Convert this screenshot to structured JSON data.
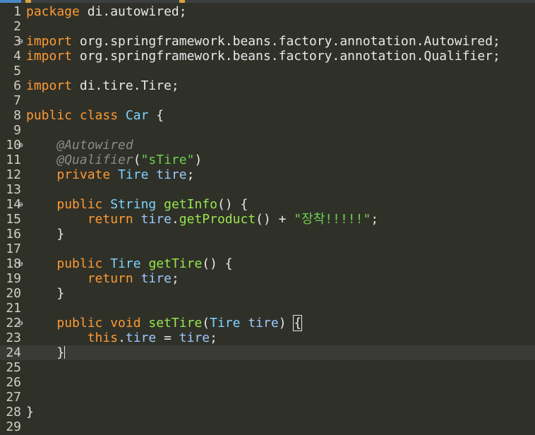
{
  "editor": {
    "language": "java",
    "current_line": 24,
    "lines": [
      {
        "n": "1",
        "fold": "",
        "tokens": [
          {
            "t": "kw",
            "v": "package"
          },
          {
            "t": "plain",
            "v": " di.autowired;"
          }
        ]
      },
      {
        "n": "2",
        "fold": "",
        "tokens": []
      },
      {
        "n": "3",
        "fold": "⊖",
        "tokens": [
          {
            "t": "kw",
            "v": "import"
          },
          {
            "t": "plain",
            "v": " org.springframework.beans.factory.annotation.Autowired;"
          }
        ]
      },
      {
        "n": "4",
        "fold": "",
        "tokens": [
          {
            "t": "kw",
            "v": "import"
          },
          {
            "t": "plain",
            "v": " org.springframework.beans.factory.annotation.Qualifier;"
          }
        ]
      },
      {
        "n": "5",
        "fold": "",
        "tokens": []
      },
      {
        "n": "6",
        "fold": "",
        "tokens": [
          {
            "t": "kw",
            "v": "import"
          },
          {
            "t": "plain",
            "v": " di.tire.Tire;"
          }
        ]
      },
      {
        "n": "7",
        "fold": "",
        "tokens": []
      },
      {
        "n": "8",
        "fold": "",
        "tokens": [
          {
            "t": "kw",
            "v": "public class"
          },
          {
            "t": "plain",
            "v": " "
          },
          {
            "t": "type",
            "v": "Car"
          },
          {
            "t": "plain",
            "v": " {"
          }
        ]
      },
      {
        "n": "9",
        "fold": "",
        "tokens": []
      },
      {
        "n": "10",
        "fold": "⊖",
        "tokens": [
          {
            "t": "plain",
            "v": "    "
          },
          {
            "t": "ann",
            "v": "@Autowired"
          }
        ]
      },
      {
        "n": "11",
        "fold": "",
        "tokens": [
          {
            "t": "plain",
            "v": "    "
          },
          {
            "t": "ann",
            "v": "@Qualifier"
          },
          {
            "t": "plain",
            "v": "("
          },
          {
            "t": "str",
            "v": "\"sTire\""
          },
          {
            "t": "plain",
            "v": ")"
          }
        ]
      },
      {
        "n": "12",
        "fold": "",
        "tokens": [
          {
            "t": "plain",
            "v": "    "
          },
          {
            "t": "kw",
            "v": "private"
          },
          {
            "t": "plain",
            "v": " "
          },
          {
            "t": "type",
            "v": "Tire"
          },
          {
            "t": "plain",
            "v": " "
          },
          {
            "t": "fld",
            "v": "tire"
          },
          {
            "t": "plain",
            "v": ";"
          }
        ]
      },
      {
        "n": "13",
        "fold": "",
        "tokens": []
      },
      {
        "n": "14",
        "fold": "⊖",
        "tokens": [
          {
            "t": "plain",
            "v": "    "
          },
          {
            "t": "kw",
            "v": "public"
          },
          {
            "t": "plain",
            "v": " "
          },
          {
            "t": "type",
            "v": "String"
          },
          {
            "t": "plain",
            "v": " "
          },
          {
            "t": "meth",
            "v": "getInfo"
          },
          {
            "t": "plain",
            "v": "() {"
          }
        ]
      },
      {
        "n": "15",
        "fold": "",
        "tokens": [
          {
            "t": "plain",
            "v": "        "
          },
          {
            "t": "kw",
            "v": "return"
          },
          {
            "t": "plain",
            "v": " "
          },
          {
            "t": "fld",
            "v": "tire"
          },
          {
            "t": "plain",
            "v": "."
          },
          {
            "t": "meth",
            "v": "getProduct"
          },
          {
            "t": "plain",
            "v": "() + "
          },
          {
            "t": "str",
            "v": "\"장착!!!!!\""
          },
          {
            "t": "plain",
            "v": ";"
          }
        ]
      },
      {
        "n": "16",
        "fold": "",
        "tokens": [
          {
            "t": "plain",
            "v": "    }"
          }
        ]
      },
      {
        "n": "17",
        "fold": "",
        "tokens": []
      },
      {
        "n": "18",
        "fold": "⊖",
        "tokens": [
          {
            "t": "plain",
            "v": "    "
          },
          {
            "t": "kw",
            "v": "public"
          },
          {
            "t": "plain",
            "v": " "
          },
          {
            "t": "type",
            "v": "Tire"
          },
          {
            "t": "plain",
            "v": " "
          },
          {
            "t": "meth",
            "v": "getTire"
          },
          {
            "t": "plain",
            "v": "() {"
          }
        ]
      },
      {
        "n": "19",
        "fold": "",
        "tokens": [
          {
            "t": "plain",
            "v": "        "
          },
          {
            "t": "kw",
            "v": "return"
          },
          {
            "t": "plain",
            "v": " "
          },
          {
            "t": "fld",
            "v": "tire"
          },
          {
            "t": "plain",
            "v": ";"
          }
        ]
      },
      {
        "n": "20",
        "fold": "",
        "tokens": [
          {
            "t": "plain",
            "v": "    }"
          }
        ]
      },
      {
        "n": "21",
        "fold": "",
        "tokens": []
      },
      {
        "n": "22",
        "fold": "⊖",
        "tokens": [
          {
            "t": "plain",
            "v": "    "
          },
          {
            "t": "kw",
            "v": "public void"
          },
          {
            "t": "plain",
            "v": " "
          },
          {
            "t": "meth",
            "v": "setTire"
          },
          {
            "t": "plain",
            "v": "("
          },
          {
            "t": "type",
            "v": "Tire"
          },
          {
            "t": "plain",
            "v": " "
          },
          {
            "t": "fld",
            "v": "tire"
          },
          {
            "t": "plain",
            "v": ") "
          },
          {
            "t": "plain",
            "v": "{",
            "box": true
          }
        ]
      },
      {
        "n": "23",
        "fold": "",
        "tokens": [
          {
            "t": "plain",
            "v": "        "
          },
          {
            "t": "kw",
            "v": "this"
          },
          {
            "t": "plain",
            "v": "."
          },
          {
            "t": "fld",
            "v": "tire"
          },
          {
            "t": "plain",
            "v": " = "
          },
          {
            "t": "fld",
            "v": "tire"
          },
          {
            "t": "plain",
            "v": ";"
          }
        ]
      },
      {
        "n": "24",
        "fold": "",
        "caret": true,
        "tokens": [
          {
            "t": "plain",
            "v": "    }"
          }
        ]
      },
      {
        "n": "25",
        "fold": "",
        "tokens": []
      },
      {
        "n": "26",
        "fold": "",
        "tokens": []
      },
      {
        "n": "27",
        "fold": "",
        "tokens": []
      },
      {
        "n": "28",
        "fold": "",
        "tokens": [
          {
            "t": "plain",
            "v": "}"
          }
        ]
      },
      {
        "n": "29",
        "fold": "",
        "tokens": []
      }
    ]
  },
  "colors": {
    "background": "#2f3129",
    "current_line": "#3a3b37",
    "keyword": "#ff9933",
    "type": "#7fd3ff",
    "annotation": "#8a8a8a",
    "string": "#6fcf4f",
    "method": "#99e64d",
    "field": "#9ec7ff"
  }
}
